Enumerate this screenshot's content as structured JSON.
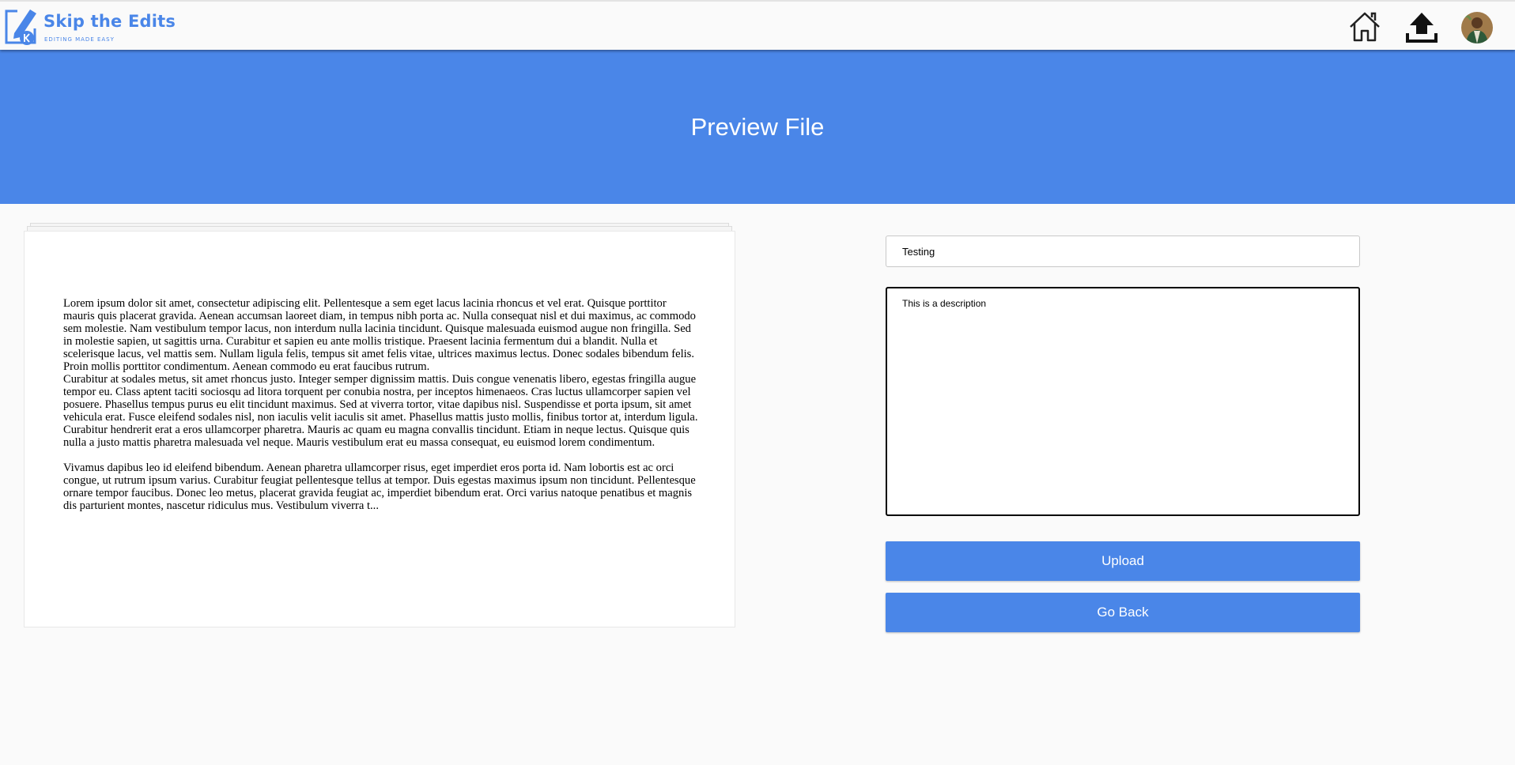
{
  "brand": {
    "title": "Skip the Edits",
    "tagline": "EDITING MADE EASY",
    "color": "#4a86e8"
  },
  "nav": {
    "icons": [
      "home-icon",
      "upload-icon",
      "avatar"
    ]
  },
  "banner": {
    "title": "Preview File",
    "color": "#4a86e8"
  },
  "preview": {
    "paragraphs": [
      "Lorem ipsum dolor sit amet, consectetur adipiscing elit. Pellentesque a sem eget lacus lacinia rhoncus et vel erat. Quisque porttitor mauris quis placerat gravida. Aenean accumsan laoreet diam, in tempus nibh porta ac. Nulla consequat nisl et dui maximus, ac commodo sem molestie. Nam vestibulum tempor lacus, non interdum nulla lacinia tincidunt. Quisque malesuada euismod augue non fringilla. Sed in molestie sapien, ut sagittis urna. Curabitur et sapien eu ante mollis tristique. Praesent lacinia fermentum dui a blandit. Nulla et scelerisque lacus, vel mattis sem. Nullam ligula felis, tempus sit amet felis vitae, ultrices maximus lectus. Donec sodales bibendum felis. Proin mollis porttitor condimentum. Aenean commodo eu erat faucibus rutrum.",
      "Curabitur at sodales metus, sit amet rhoncus justo. Integer semper dignissim mattis. Duis congue venenatis libero, egestas fringilla augue tempor eu. Class aptent taciti sociosqu ad litora torquent per conubia nostra, per inceptos himenaeos. Cras luctus ullamcorper sapien vel posuere. Phasellus tempus purus eu elit tincidunt maximus. Sed at viverra tortor, vitae dapibus nisl. Suspendisse et porta ipsum, sit amet vehicula erat. Fusce eleifend sodales nisl, non iaculis velit iaculis sit amet. Phasellus mattis justo mollis, finibus tortor at, interdum ligula. Curabitur hendrerit erat a eros ullamcorper pharetra. Mauris ac quam eu magna convallis tincidunt. Etiam in neque lectus. Quisque quis nulla a justo mattis pharetra malesuada vel neque. Mauris vestibulum erat eu massa consequat, eu euismod lorem condimentum.",
      "Vivamus dapibus leo id eleifend bibendum. Aenean pharetra ullamcorper risus, eget imperdiet eros porta id. Nam lobortis est ac orci congue, ut rutrum ipsum varius. Curabitur feugiat pellentesque tellus at tempor. Duis egestas maximus ipsum non tincidunt. Pellentesque ornare tempor faucibus. Donec leo metus, placerat gravida feugiat ac, imperdiet bibendum erat. Orci varius natoque penatibus et magnis dis parturient montes, nascetur ridiculus mus. Vestibulum viverra t..."
    ]
  },
  "form": {
    "title_value": "Testing",
    "description_value": "This is a description",
    "upload_label": "Upload",
    "back_label": "Go Back"
  }
}
